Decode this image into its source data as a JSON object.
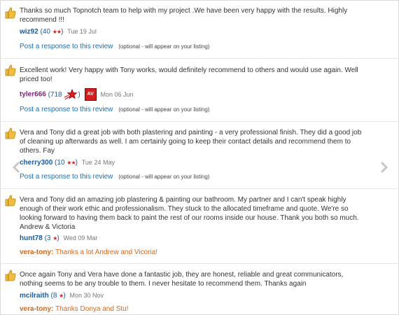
{
  "reviews": [
    {
      "text": "Thanks so much Topnotch team to help with my project .We have been very happy with the results. Highly recommend !!!",
      "user": "wiz92",
      "count": "40",
      "stars": "★★",
      "date": "Tue 19 Jul",
      "post_link": "Post a response to this review",
      "post_note": "(optional - will appear on your listing)"
    },
    {
      "text": "Excellent work! Very happy with Tony works, would definitely recommend to others and would use again. Well priced too!",
      "user": "tyler666",
      "count": "718",
      "badge": "AV",
      "date": "Mon 06 Jun",
      "post_link": "Post a response to this review",
      "post_note": "(optional - will appear on your listing)"
    },
    {
      "text": "Vera and Tony did a great job with both plastering and painting - a very professional finish. They did a good job of cleaning up afterwards as well. I am certainly going to keep their contact details and recommend them to others. Fay",
      "user": "cherry300",
      "count": "10",
      "stars": "★★",
      "date": "Tue 24 May",
      "post_link": "Post a response to this review",
      "post_note": "(optional - will appear on your listing)"
    },
    {
      "text": "Vera and Tony did an amazing job plastering & painting our bathroom. My partner and I can't speak highly enough of their work ethic and professionalism. They stuck to the allocated timeframe and quote. We're so looking forward to having them back to paint the rest of our rooms inside our house. Thank you both so much. Andrew & Victoria",
      "user": "hunt78",
      "count": "3",
      "stars": "★",
      "date": "Wed 09 Mar",
      "reply_name": "vera-tony:",
      "reply_msg": "Thanks a lot Andrew and Vicoria!"
    },
    {
      "text": "Once again Tony and Vera have done a fantastic job, they are honest, reliable and great communicators, nothing seems to be any trouble to them. I never hesitate to recommend them. Thanks again",
      "user": "mcilraith",
      "count": "8",
      "stars": "★",
      "date": "Mon 30 Nov",
      "reply_name": "vera-tony:",
      "reply_msg": "Thanks Donya and Stu!"
    }
  ]
}
